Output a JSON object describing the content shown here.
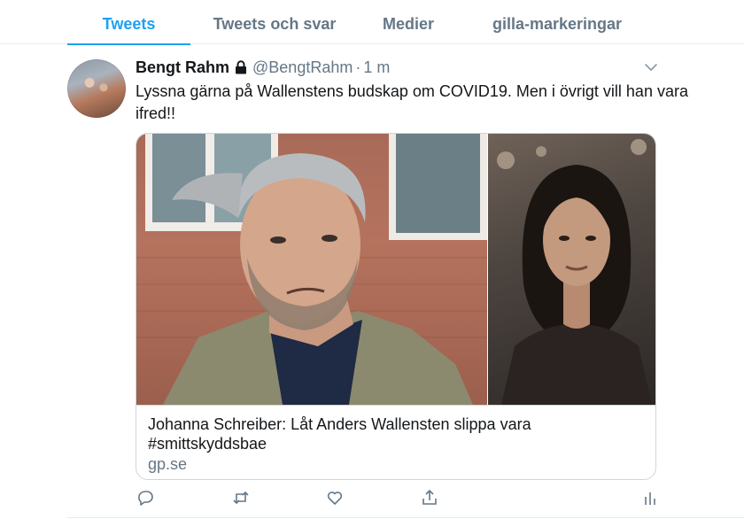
{
  "tabs": [
    {
      "label": "Tweets",
      "active": true
    },
    {
      "label": "Tweets och svar",
      "active": false
    },
    {
      "label": "Medier",
      "active": false
    },
    {
      "label": "gilla-markeringar",
      "active": false
    }
  ],
  "tweet": {
    "author_name": "Bengt Rahm",
    "protected_icon": "lock-icon",
    "handle": "@BengtRahm",
    "separator": "·",
    "time": "1 m",
    "text": "Lyssna gärna på Wallenstens budskap om COVID19. Men i övrigt vill han vara ifred!!",
    "card": {
      "title": "Johanna Schreiber: Låt Anders Wallensten slippa vara #smittskyddsbae",
      "domain": "gp.se"
    },
    "actions": [
      "reply-icon",
      "retweet-icon",
      "like-icon",
      "share-icon",
      "analytics-icon"
    ]
  },
  "colors": {
    "accent": "#1da1f2",
    "secondary_text": "#657786",
    "border": "#ccd6dd"
  }
}
